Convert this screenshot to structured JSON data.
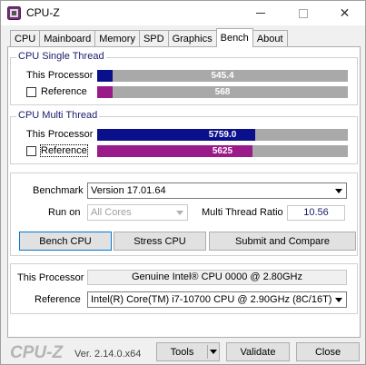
{
  "window": {
    "title": "CPU-Z",
    "icon": "cpu-z-app-icon",
    "controls": {
      "minimize": "minimize-icon",
      "maximize": "maximize-icon",
      "close": "✕"
    }
  },
  "tabs": [
    {
      "label": "CPU",
      "active": false
    },
    {
      "label": "Mainboard",
      "active": false
    },
    {
      "label": "Memory",
      "active": false
    },
    {
      "label": "SPD",
      "active": false
    },
    {
      "label": "Graphics",
      "active": false
    },
    {
      "label": "Bench",
      "active": true
    },
    {
      "label": "About",
      "active": false
    }
  ],
  "single_thread": {
    "group_label": "CPU Single Thread",
    "this_label": "This Processor",
    "this_value": "545.4",
    "this_fraction": 0.06,
    "ref_label": "Reference",
    "ref_value": "568",
    "ref_fraction": 0.06,
    "ref_checked": false
  },
  "multi_thread": {
    "group_label": "CPU Multi Thread",
    "this_label": "This Processor",
    "this_value": "5759.0",
    "this_fraction": 0.63,
    "ref_label": "Reference",
    "ref_value": "5625",
    "ref_fraction": 0.62,
    "ref_checked": false
  },
  "bench": {
    "benchmark_label": "Benchmark",
    "benchmark_value": "Version 17.01.64",
    "runon_label": "Run on",
    "runon_value": "All Cores",
    "ratio_label": "Multi Thread Ratio",
    "ratio_value": "10.56",
    "bench_cpu_button": "Bench CPU",
    "stress_cpu_button": "Stress CPU",
    "submit_button": "Submit and Compare"
  },
  "compare": {
    "this_label": "This Processor",
    "this_value": "Genuine Intel® CPU 0000 @ 2.80GHz",
    "ref_label": "Reference",
    "ref_value": "Intel(R) Core(TM) i7-10700 CPU @ 2.90GHz (8C/16T)"
  },
  "footer": {
    "brand": "CPU-Z",
    "version": "Ver. 2.14.0.x64",
    "tools_button": "Tools",
    "validate_button": "Validate",
    "close_button": "Close"
  },
  "colors": {
    "this_processor_bar": "#0a0f8c",
    "reference_bar": "#9b1a8a",
    "bar_background": "#a9a9a9",
    "group_label": "#1a1a6e"
  }
}
